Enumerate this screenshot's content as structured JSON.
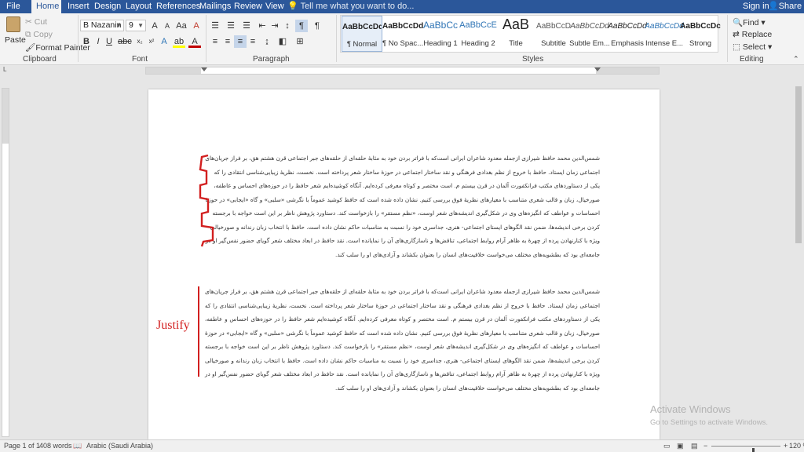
{
  "tabs": [
    "File",
    "Home",
    "Insert",
    "Design",
    "Layout",
    "References",
    "Mailings",
    "Review",
    "View"
  ],
  "active_tab": "Home",
  "tell_me": "Tell me what you want to do...",
  "sign_in": "Sign in",
  "share": "Share",
  "clipboard": {
    "paste": "Paste",
    "cut": "Cut",
    "copy": "Copy",
    "format_painter": "Format Painter",
    "label": "Clipboard"
  },
  "font": {
    "name": "B Nazanin",
    "size": "9",
    "label": "Font"
  },
  "paragraph": {
    "label": "Paragraph"
  },
  "styles": {
    "label": "Styles",
    "items": [
      {
        "sample": "AaBbCcDd",
        "name": "¶ Normal"
      },
      {
        "sample": "AaBbCcDd",
        "name": "¶ No Spac..."
      },
      {
        "sample": "AaBbCc",
        "name": "Heading 1"
      },
      {
        "sample": "AaBbCcE",
        "name": "Heading 2"
      },
      {
        "sample": "AaB",
        "name": "Title"
      },
      {
        "sample": "AaBbCcD",
        "name": "Subtitle"
      },
      {
        "sample": "AaBbCcDd",
        "name": "Subtle Em..."
      },
      {
        "sample": "AaBbCcDd",
        "name": "Emphasis"
      },
      {
        "sample": "AaBbCcDd",
        "name": "Intense E..."
      },
      {
        "sample": "AaBbCcDc",
        "name": "Strong"
      }
    ]
  },
  "editing": {
    "find": "Find",
    "replace": "Replace",
    "select": "Select",
    "label": "Editing"
  },
  "document": {
    "paragraph_text": "شمس‌الدین محمد حافظ شیرازی ازجمله معدود شاعران ایرانی است‌که با فراتر بردن خود به مثابهٔ حلقه‌ای از حلقه‌های جبر اجتماعی قرن هشتم هق، بر فراز جریان‌های اجتماعی زمان ایستاد. حافظ با خروج از نظم بغدادی فرهنگی و نقد ساختار اجتماعی در حوزهٔ ساختار شعر پرداخته است. نخست، نظریهٔ زیبایی‌شناسی انتقادی را که یکی از دستاوردهای مکتب فرانکفورت آلمان در قرن بیستم م. است مختصر و کوتاه معرفی کرده‌ایم. آنگاه کوشیده‌ایم شعر حافظ را در حوزه‌های احساس و عاطفه، صورخیال، زبان و قالب شعری متناسب با معیارهای نظریهٔ فوق بررسی کنیم. نشان داده شده است که حافظ کوشید عموماً با نگرشی «سلبی» و گاه «ایجابی» در حوزهٔ احساسات و عواطف که انگیزه‌های وی در شکل‌گیری اندیشه‌های شعر اوست، «نظم مستقر» را بازخواست کند. دستاورد پژوهش ناظر بر این است خواجه با برجسته کردن برخی اندیشه‌ها، ضمن نقد الگوهای ایستای اجتماعی- هنری، جداسری خود را نسبت به مناسبات حاکم نشان داده است. حافظ با انتخاب زبان رندانه و صورخیالی ویژه با کنارنهادن پرده از چهرهٔ به ظاهر آرام روابط اجتماعی، تناقض‌ها و ناسازگاری‌های آن را نمایانده است. نقد حافظ در ابعاد مختلف شعر گویای حضور نفس‌گیر او در جامعه‌ای بود که بطشویه‌های مختلف می‌خواست خلاقیت‌های انسان را بعنوان بکشاند و آزادی‌های او را سلب کند.",
    "justify_label": "Justify"
  },
  "status": {
    "page": "Page 1 of 1",
    "words": "408 words",
    "language": "Arabic (Saudi Arabia)",
    "zoom": "120 %",
    "zoom_level": 0.6
  },
  "watermark": {
    "title": "Activate Windows",
    "subtitle": "Go to Settings to activate Windows."
  },
  "colors": {
    "titlebar": "#2b579a",
    "annotation": "#d21f1f"
  }
}
